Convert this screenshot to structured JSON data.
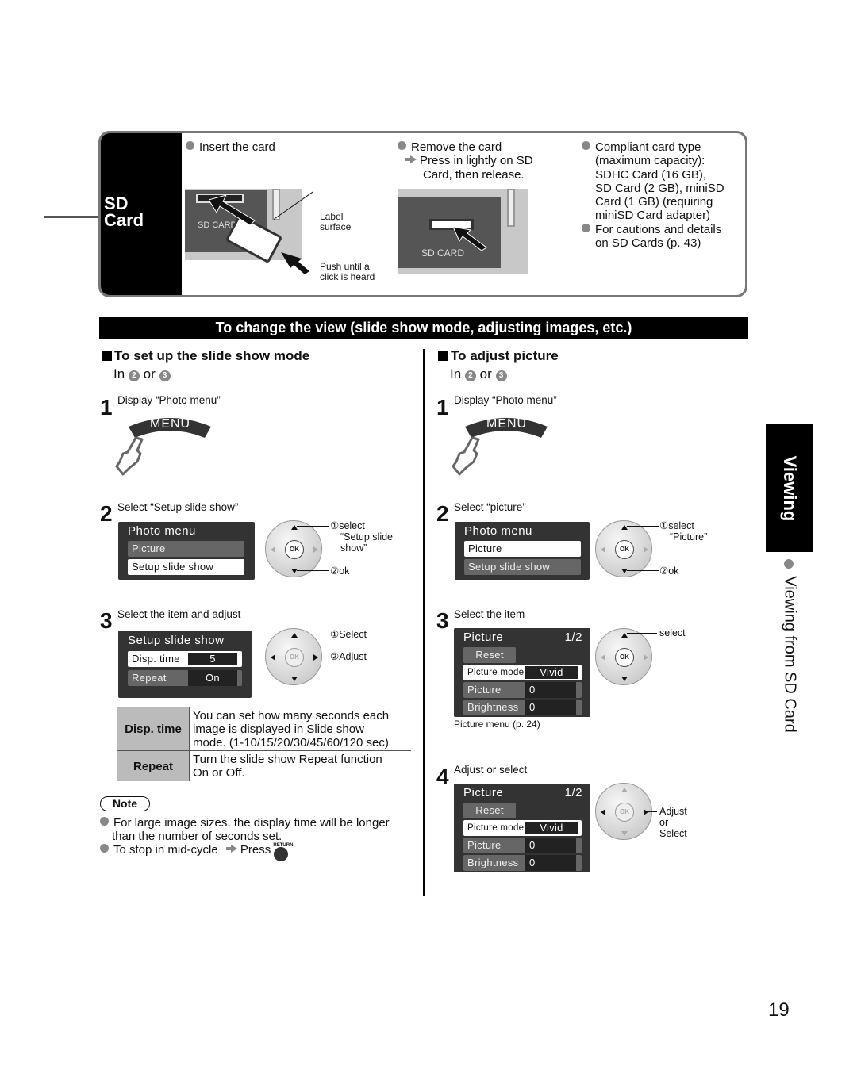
{
  "sd_panel": {
    "title_line1": "SD",
    "title_line2": "Card",
    "insert": {
      "heading": "Insert the card",
      "slot_label": "SD CARD",
      "label_surface": [
        "Label",
        "surface"
      ],
      "push_hint": [
        "Push until a",
        "click is heard"
      ]
    },
    "remove": {
      "heading": "Remove the card",
      "instruction_line1": "Press in lightly on SD",
      "instruction_line2": "Card, then release.",
      "slot_label": "SD CARD"
    },
    "info": {
      "compliant_lines": [
        "Compliant card type",
        "(maximum capacity):",
        "SDHC Card (16 GB),",
        "SD Card (2 GB), miniSD",
        "Card (1 GB) (requiring",
        "miniSD Card adapter)"
      ],
      "cautions_lines": [
        "For cautions and details",
        "on SD Cards (p. 43)"
      ]
    }
  },
  "banner": "To change the view (slide show mode, adjusting images, etc.)",
  "left": {
    "heading": "To set up the slide show mode",
    "in_prefix": "In",
    "in_or": "or",
    "circ_a": "2",
    "circ_b": "3",
    "step1": {
      "num": "1",
      "text": "Display “Photo menu”",
      "button": "MENU"
    },
    "step2": {
      "num": "2",
      "text": "Select “Setup slide show”",
      "menu_title": "Photo menu",
      "items": [
        "Picture",
        "Setup slide show"
      ],
      "ok_label": "OK",
      "callout1": [
        "①select",
        "“Setup slide",
        "show”"
      ],
      "callout2": "②ok"
    },
    "step3": {
      "num": "3",
      "text": "Select the item and adjust",
      "menu_title": "Setup slide show",
      "rows": [
        {
          "label": "Disp. time",
          "value": "5"
        },
        {
          "label": "Repeat",
          "value": "On"
        }
      ],
      "ok_label": "OK",
      "callout1": "①Select",
      "callout2": "②Adjust"
    },
    "table": [
      {
        "header": "Disp. time",
        "desc": [
          "You can set how many seconds each",
          "image is displayed in Slide show",
          "mode. (1-10/15/20/30/45/60/120 sec)"
        ]
      },
      {
        "header": "Repeat",
        "desc": [
          "Turn the slide show Repeat function",
          "On or Off."
        ]
      }
    ],
    "note": {
      "label": "Note",
      "item1_line1": "For large image sizes, the display time will be longer",
      "item1_line2": "than the number of seconds set.",
      "item2_prefix": "To stop in mid-cycle",
      "item2_press": "Press",
      "return_label": "RETURN"
    }
  },
  "right": {
    "heading": "To adjust picture",
    "in_prefix": "In",
    "in_or": "or",
    "circ_a": "2",
    "circ_b": "3",
    "step1": {
      "num": "1",
      "text": "Display “Photo menu”",
      "button": "MENU"
    },
    "step2": {
      "num": "2",
      "text": "Select “picture”",
      "menu_title": "Photo menu",
      "items": [
        "Picture",
        "Setup slide show"
      ],
      "ok_label": "OK",
      "callout1": [
        "①select",
        "“Picture”"
      ],
      "callout2": "②ok"
    },
    "step3": {
      "num": "3",
      "text": "Select the item",
      "menu_title": "Picture",
      "page": "1/2",
      "reset": "Reset",
      "rows": [
        {
          "label": "Picture mode",
          "value": "Vivid"
        },
        {
          "label": "Picture",
          "value": "0"
        },
        {
          "label": "Brightness",
          "value": "0"
        }
      ],
      "caption": "Picture menu (p. 24)",
      "ok_label": "OK",
      "callout": "select"
    },
    "step4": {
      "num": "4",
      "text": "Adjust or select",
      "menu_title": "Picture",
      "page": "1/2",
      "reset": "Reset",
      "rows": [
        {
          "label": "Picture mode",
          "value": "Vivid"
        },
        {
          "label": "Picture",
          "value": "0"
        },
        {
          "label": "Brightness",
          "value": "0"
        }
      ],
      "ok_label": "OK",
      "callout": [
        "Adjust",
        "or",
        "Select"
      ]
    }
  },
  "side": {
    "tab": "Viewing",
    "sub": "Viewing from SD Card"
  },
  "page_number": "19"
}
